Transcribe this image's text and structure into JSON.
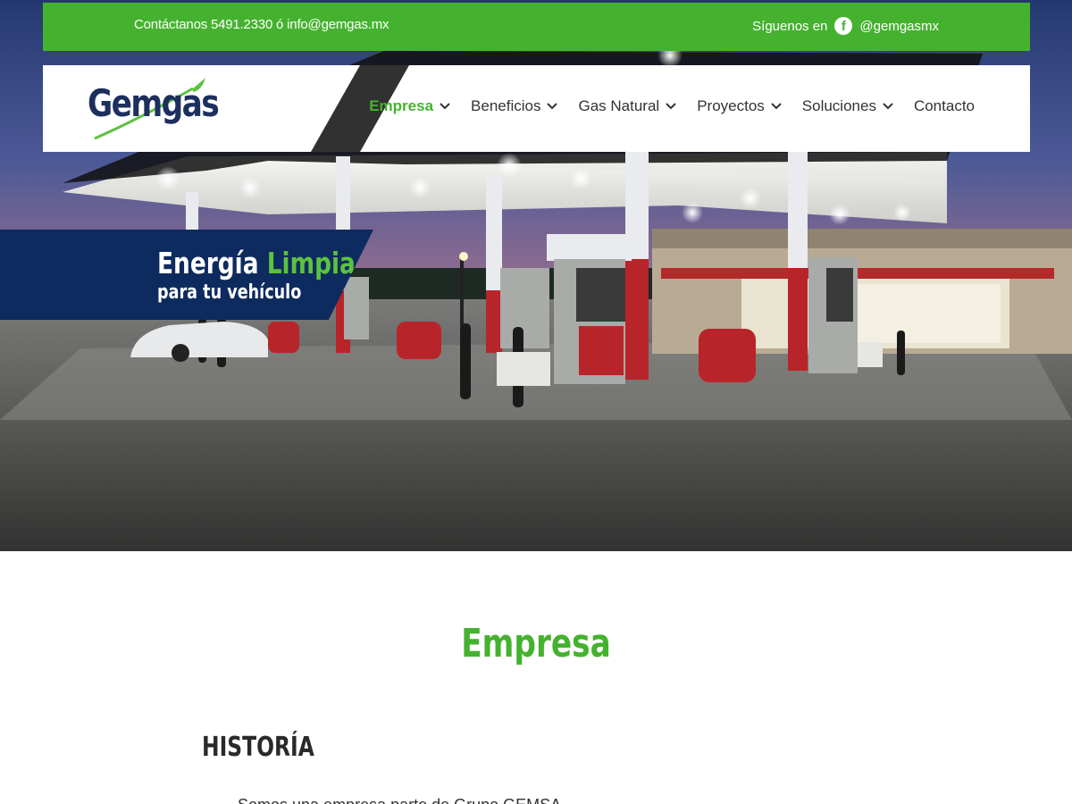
{
  "topbar": {
    "contact_text": "Contáctanos 5491.2330 ó info@gemgas.mx",
    "social_label": "Síguenos en",
    "social_icon": "facebook-icon",
    "social_handle": "@gemgasmx"
  },
  "header": {
    "logo_text": "Gemgas",
    "nav": [
      {
        "label": "Empresa",
        "active": true,
        "dropdown": true
      },
      {
        "label": "Beneficios",
        "active": false,
        "dropdown": true
      },
      {
        "label": "Gas Natural",
        "active": false,
        "dropdown": true
      },
      {
        "label": "Proyectos",
        "active": false,
        "dropdown": true
      },
      {
        "label": "Soluciones",
        "active": false,
        "dropdown": true
      },
      {
        "label": "Contacto",
        "active": false,
        "dropdown": false
      }
    ]
  },
  "banner": {
    "line1_a": "Energía",
    "line1_b": "Limpia",
    "line2": "para tu vehículo"
  },
  "main": {
    "section_title": "Empresa",
    "subheading": "HISTORÍA",
    "paragraph_start": "Somos una empresa parte de Grupo GEMSA, ..."
  },
  "colors": {
    "brand_green": "#45b22f",
    "brand_navy": "#0d2b5e",
    "text_dark": "#333333"
  }
}
